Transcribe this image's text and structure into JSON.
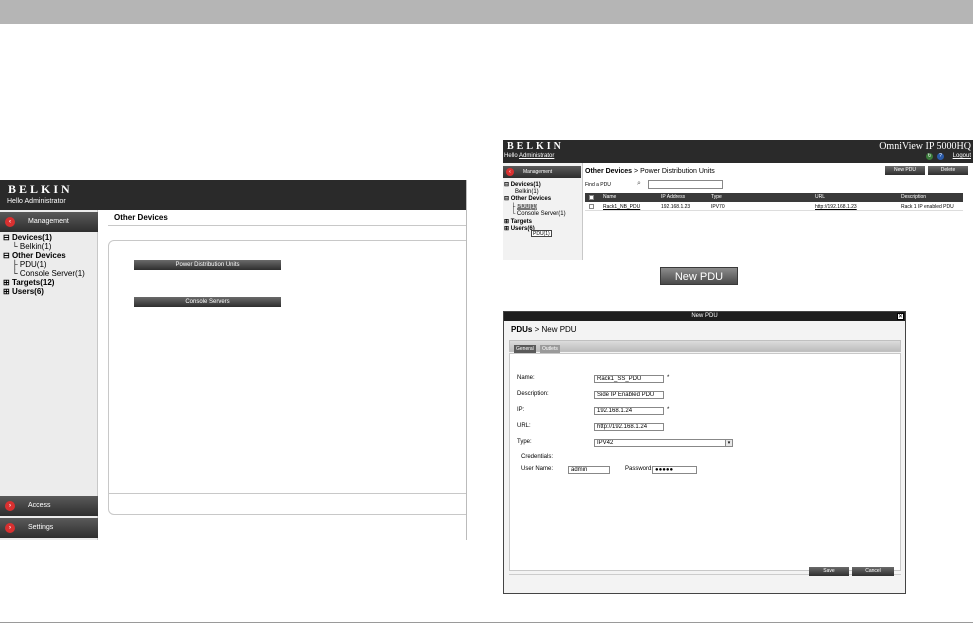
{
  "shot_left": {
    "brand": "BELKIN",
    "greeting": "Hello Administrator",
    "sidebar": {
      "management_label": "Management",
      "access_label": "Access",
      "settings_label": "Settings",
      "tree": [
        {
          "label": "Devices(1)",
          "level": 0,
          "bold": true
        },
        {
          "label": "Belkin(1)",
          "level": 1,
          "bold": false
        },
        {
          "label": "Other Devices",
          "level": 0,
          "bold": true,
          "selected": true
        },
        {
          "label": "PDU(1)",
          "level": 1,
          "bold": false
        },
        {
          "label": "Console Server(1)",
          "level": 1,
          "bold": false
        },
        {
          "label": "Targets(12)",
          "level": 0,
          "bold": true
        },
        {
          "label": "Users(6)",
          "level": 0,
          "bold": true
        }
      ]
    },
    "main_title": "Other Devices",
    "buttons": {
      "power_distribution_units": "Power Distribution Units",
      "console_servers": "Console Servers"
    }
  },
  "shot_right": {
    "brand": "BELKIN",
    "greeting_prefix": "Hello ",
    "greeting_user": "Administrator",
    "product": "OmniView IP 5000HQ",
    "logout": "Logout",
    "management_label": "Management",
    "tree": [
      {
        "label": "Devices(1)",
        "bold": true
      },
      {
        "label": "Belkin(1)",
        "bold": false
      },
      {
        "label": "Other Devices",
        "bold": true
      },
      {
        "label": "PDU(1)",
        "bold": false
      },
      {
        "label": "Console Server(1)",
        "bold": false
      },
      {
        "label": "Targets",
        "bold": true
      },
      {
        "label": "Users(6)",
        "bold": true
      }
    ],
    "tooltip": "PDU(1)",
    "page_title_prefix": "Other Devices",
    "page_title_suffix": " > Power Distribution Units",
    "new_pdu_button": "New PDU",
    "delete_button": "Delete",
    "find_label": "Find a PDU",
    "find_placeholder": "",
    "table": {
      "columns": [
        "Name",
        "IP Address",
        "Type",
        "URL",
        "Description"
      ],
      "rows": [
        {
          "name": "Rack1_NB_PDU",
          "ip": "192.168.1.23",
          "type": "IPV70",
          "url": "http://192.168.1.23",
          "description": "Rack 1 IP enabled PDU"
        }
      ]
    }
  },
  "new_pdu_standalone_button": "New PDU",
  "dialog": {
    "title": "New PDU",
    "close": "✕",
    "crumb_parent": "PDUs",
    "crumb_current": " > New PDU",
    "tabs": {
      "general": "General",
      "outlets": "Outlets"
    },
    "fields": {
      "name_label": "Name:",
      "name_value": "Rack1_SS_PDU",
      "description_label": "Description:",
      "description_value": "Side IP Enabled PDU",
      "ip_label": "IP:",
      "ip_value": "192.168.1.24",
      "url_label": "URL:",
      "url_value": "http://192.168.1.24",
      "type_label": "Type:",
      "type_value": "IPV42",
      "credentials_label": "Credentials:",
      "username_label": "User Name:",
      "username_value": "admin",
      "password_label": "Password:",
      "password_value": "●●●●●",
      "required_mark": "*"
    },
    "save": "Save",
    "cancel": "Cancel"
  }
}
